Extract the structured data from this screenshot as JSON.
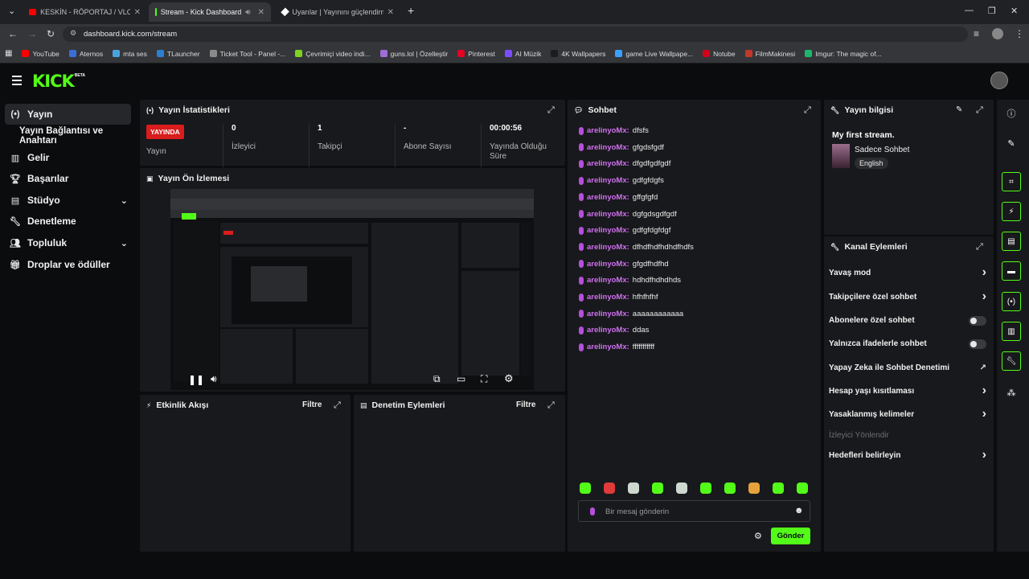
{
  "browser": {
    "tabs": [
      {
        "title": "KESKİN - RÖPORTAJ / VLOG - F",
        "active": false
      },
      {
        "title": "Stream - Kick Dashboard",
        "active": true
      },
      {
        "title": "Uyarılar | Yayınını güçlendirme",
        "active": false
      }
    ],
    "url": "dashboard.kick.com/stream",
    "bookmarks": [
      {
        "label": "YouTube",
        "color": "#ff0000"
      },
      {
        "label": "Aternos",
        "color": "#3b6dd8"
      },
      {
        "label": "mta ses",
        "color": "#4aa3df"
      },
      {
        "label": "TLauncher",
        "color": "#2d7fd3"
      },
      {
        "label": "Ticket Tool - Panel -...",
        "color": "#8a8a8a"
      },
      {
        "label": "Çevrimiçi video indi...",
        "color": "#7ed321"
      },
      {
        "label": "guns.lol | Özelleştir",
        "color": "#a06cd5"
      },
      {
        "label": "Pinterest",
        "color": "#e60023"
      },
      {
        "label": "AI Müzik",
        "color": "#7b4dff"
      },
      {
        "label": "4K Wallpapers",
        "color": "#1c1c1c"
      },
      {
        "label": "game Live Wallpape...",
        "color": "#3aa0ff"
      },
      {
        "label": "Notube",
        "color": "#d0021b"
      },
      {
        "label": "FilmMakinesi",
        "color": "#c0392b"
      },
      {
        "label": "Imgur: The magic of...",
        "color": "#1bb76e"
      }
    ]
  },
  "app": {
    "logo": "KICK",
    "logo_tag": "BETA",
    "accent": "#53fc18"
  },
  "sidebar": {
    "items": [
      {
        "label": "Yayın",
        "icon": "broadcast-icon",
        "active": true
      },
      {
        "label": "Yayın Bağlantısı ve Anahtarı",
        "icon": "",
        "active": false
      },
      {
        "label": "Gelir",
        "icon": "revenue-icon",
        "active": false
      },
      {
        "label": "Başarılar",
        "icon": "trophy-icon",
        "active": false
      },
      {
        "label": "Stüdyo",
        "icon": "studio-icon",
        "active": false
      },
      {
        "label": "Denetleme",
        "icon": "wrench-icon",
        "active": false
      },
      {
        "label": "Topluluk",
        "icon": "community-icon",
        "active": false
      },
      {
        "label": "Droplar ve ödüller",
        "icon": "gift-icon",
        "active": false
      }
    ]
  },
  "stats": {
    "title": "Yayın İstatistikleri",
    "live_badge": "YAYINDA",
    "items": [
      {
        "value": "",
        "label": "Yayın"
      },
      {
        "value": "0",
        "label": "İzleyici"
      },
      {
        "value": "1",
        "label": "Takipçi"
      },
      {
        "value": "-",
        "label": "Abone Sayısı"
      },
      {
        "value": "00:00:56",
        "label": "Yayında Olduğu Süre"
      }
    ]
  },
  "preview": {
    "title": "Yayın Ön İzlemesi"
  },
  "activity": {
    "title": "Etkinlik Akışı",
    "filter": "Filtre"
  },
  "moderation": {
    "title": "Denetim Eylemleri",
    "filter": "Filtre"
  },
  "chat": {
    "title": "Sohbet",
    "messages": [
      {
        "user": "arelinyoMx:",
        "text": "dfsfs"
      },
      {
        "user": "arelinyoMx:",
        "text": "gfgdsfgdf"
      },
      {
        "user": "arelinyoMx:",
        "text": "dfgdfgdfgdf"
      },
      {
        "user": "arelinyoMx:",
        "text": "gdfgfdgfs"
      },
      {
        "user": "arelinyoMx:",
        "text": "gffgfgfd"
      },
      {
        "user": "arelinyoMx:",
        "text": "dgfgdsgdfgdf"
      },
      {
        "user": "arelinyoMx:",
        "text": "gdfgfdgfdgf"
      },
      {
        "user": "arelinyoMx:",
        "text": "dfhdfhdfhdhdfhdfs"
      },
      {
        "user": "arelinyoMx:",
        "text": "gfgdfhdfhd"
      },
      {
        "user": "arelinyoMx:",
        "text": "hdhdfhdhdhds"
      },
      {
        "user": "arelinyoMx:",
        "text": "hfhfhfhf"
      },
      {
        "user": "arelinyoMx:",
        "text": "aaaaaaaaaaaa"
      },
      {
        "user": "arelinyoMx:",
        "text": "ddas"
      },
      {
        "user": "arelinyoMx:",
        "text": "fffffffffff"
      }
    ],
    "placeholder": "Bir mesaj gönderin",
    "send": "Gönder"
  },
  "stream_info": {
    "title": "Yayın bilgisi",
    "stream_title": "My first stream.",
    "category": "Sadece Sohbet",
    "language": "English"
  },
  "channel_actions": {
    "title": "Kanal Eylemleri",
    "items": [
      {
        "label": "Yavaş mod",
        "control": "chevron"
      },
      {
        "label": "Takipçilere özel sohbet",
        "control": "chevron"
      },
      {
        "label": "Abonelere özel sohbet",
        "control": "toggle"
      },
      {
        "label": "Yalnızca ifadelerle sohbet",
        "control": "toggle"
      },
      {
        "label": "Yapay Zeka ile Sohbet Denetimi",
        "control": "external"
      },
      {
        "label": "Hesap yaşı kısıtlaması",
        "control": "chevron"
      },
      {
        "label": "Yasaklanmış kelimeler",
        "control": "chevron"
      },
      {
        "label": "İzleyici Yönlendir",
        "control": "disabled"
      },
      {
        "label": "Hedefleri belirleyin",
        "control": "chevron"
      }
    ]
  }
}
